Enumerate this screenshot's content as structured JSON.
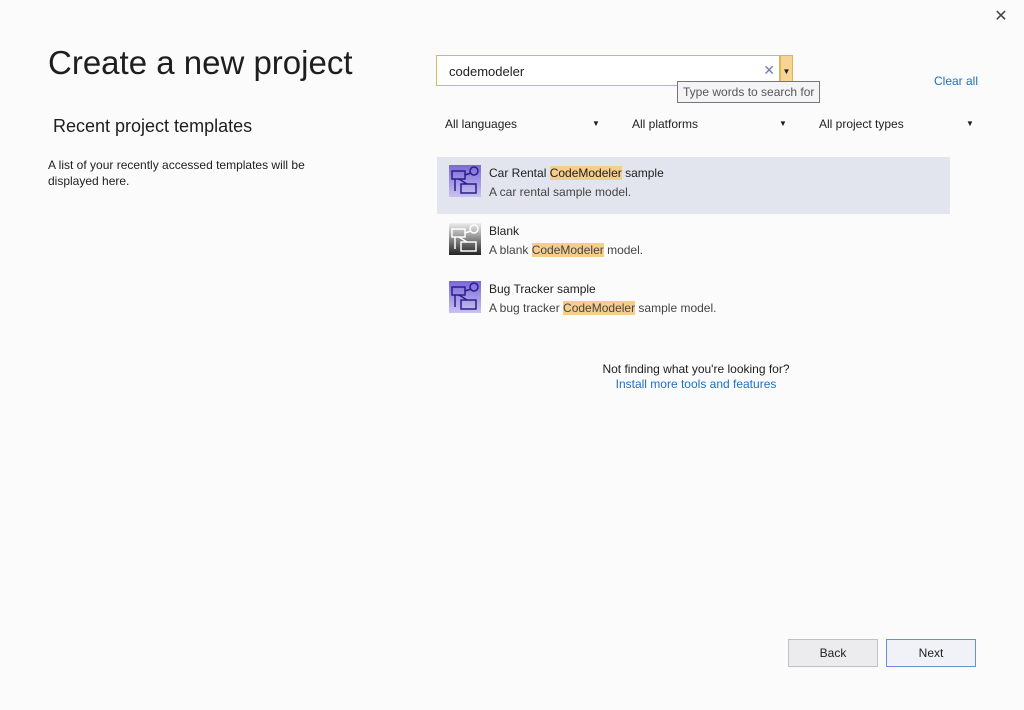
{
  "window": {
    "close_icon": "close-icon"
  },
  "title": "Create a new project",
  "recent": {
    "heading": "Recent project templates",
    "description": "A list of your recently accessed templates will be displayed here."
  },
  "search": {
    "value": "codemodeler",
    "tooltip": "Type words to search for",
    "clear_all": "Clear all"
  },
  "filters": [
    {
      "label": "All languages"
    },
    {
      "label": "All platforms"
    },
    {
      "label": "All project types"
    }
  ],
  "highlight_color": "#f6cd8a",
  "templates": [
    {
      "name_pre": "Car Rental ",
      "name_hl": "CodeModeler",
      "name_post": " sample",
      "desc_pre": "A car rental sample model.",
      "desc_hl": "",
      "desc_post": "",
      "icon": "diagram-icon-purple",
      "selected": true
    },
    {
      "name_pre": "Blank",
      "name_hl": "",
      "name_post": "",
      "desc_pre": "A blank ",
      "desc_hl": "CodeModeler",
      "desc_post": " model.",
      "icon": "diagram-icon-gray",
      "selected": false
    },
    {
      "name_pre": "Bug Tracker sample",
      "name_hl": "",
      "name_post": "",
      "desc_pre": "A bug tracker ",
      "desc_hl": "CodeModeler",
      "desc_post": " sample model.",
      "icon": "diagram-icon-purple",
      "selected": false
    }
  ],
  "help": {
    "text": "Not finding what you're looking for?",
    "link": "Install more tools and features"
  },
  "buttons": {
    "back": "Back",
    "next": "Next"
  }
}
